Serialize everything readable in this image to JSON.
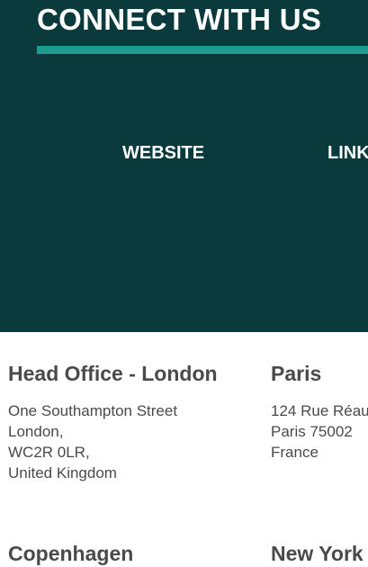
{
  "hero": {
    "title": "CONNECT WITH US",
    "accent_color": "#1e9c8f",
    "background_color": "#0b3a3d",
    "links": [
      {
        "label": "WEBSITE"
      },
      {
        "label": "LINK"
      }
    ]
  },
  "offices": [
    {
      "name": "Head Office - London",
      "address": [
        "One Southampton Street",
        "London,",
        "WC2R 0LR,",
        "United Kingdom"
      ]
    },
    {
      "name": "Paris",
      "address": [
        "124 Rue Réau",
        "Paris 75002",
        "France"
      ]
    },
    {
      "name": "Copenhagen",
      "address": []
    },
    {
      "name": "New York",
      "address": []
    }
  ]
}
